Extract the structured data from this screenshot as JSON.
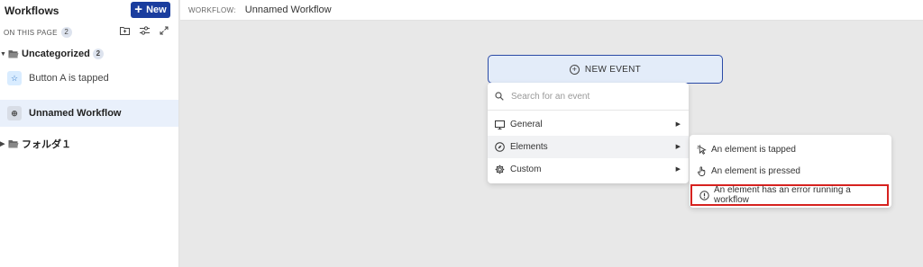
{
  "sidebar": {
    "title": "Workflows",
    "new_button": "New",
    "on_page_label": "ON THIS PAGE",
    "on_page_count": "2",
    "folders": [
      {
        "name": "Uncategorized",
        "count": "2"
      },
      {
        "name": "フォルダ１"
      }
    ],
    "workflows": [
      {
        "name": "Button A is tapped"
      },
      {
        "name": "Unnamed Workflow"
      }
    ]
  },
  "topbar": {
    "label": "WORKFLOW:",
    "name": "Unnamed Workflow"
  },
  "canvas": {
    "new_event_label": "NEW EVENT"
  },
  "dropdown": {
    "search_placeholder": "Search for an event",
    "items": [
      {
        "label": "General"
      },
      {
        "label": "Elements"
      },
      {
        "label": "Custom"
      }
    ]
  },
  "submenu": {
    "items": [
      {
        "label": "An element is tapped"
      },
      {
        "label": "An element is pressed"
      },
      {
        "label": "An element has an error running a workflow"
      }
    ],
    "highlight_color": "#d6221f"
  },
  "colors": {
    "accent": "#1a3d9e",
    "selected_row": "#e9f0fb",
    "canvas_bg": "#e8e8e8"
  }
}
